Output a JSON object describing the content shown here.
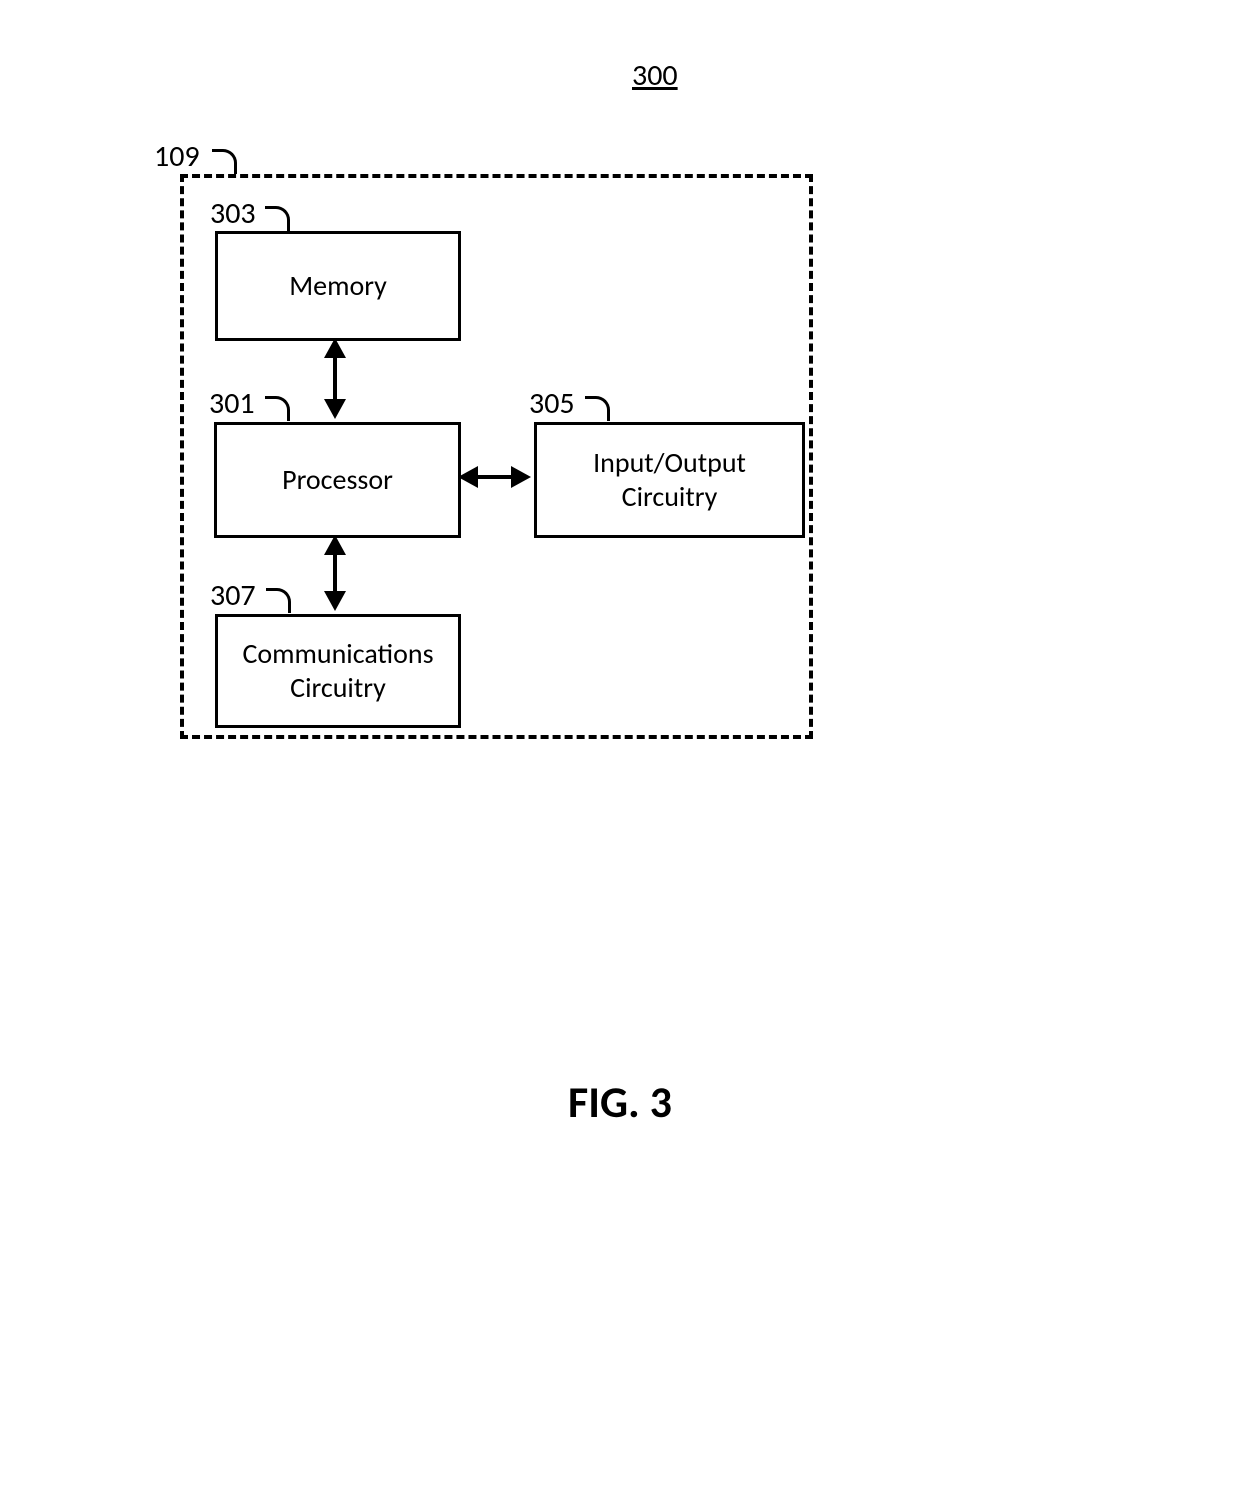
{
  "figure": {
    "number_top": "300",
    "outer_ref": "109",
    "caption": "FIG. 3"
  },
  "blocks": {
    "memory": {
      "ref": "303",
      "label": "Memory"
    },
    "processor": {
      "ref": "301",
      "label": "Processor"
    },
    "io": {
      "ref": "305",
      "label": "Input/Output Circuitry"
    },
    "comm": {
      "ref": "307",
      "label": "Communications\nCircuitry"
    }
  }
}
